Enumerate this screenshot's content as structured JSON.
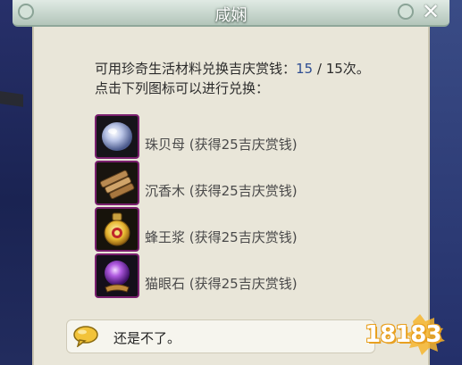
{
  "window": {
    "title": "咸娴",
    "close_glyph": "✕"
  },
  "info": {
    "line1_prefix": "可用珍奇生活材料兑换吉庆赏钱：",
    "current": "15",
    "separator": " / ",
    "total": "15次。",
    "line2": "点击下列图标可以进行兑换："
  },
  "items": [
    {
      "label": "珠贝母 (获得25吉庆赏钱)",
      "icon": "pearl-icon"
    },
    {
      "label": "沉香木 (获得25吉庆赏钱)",
      "icon": "wood-icon"
    },
    {
      "label": "蜂王浆 (获得25吉庆赏钱)",
      "icon": "royal-jelly-icon"
    },
    {
      "label": "猫眼石 (获得25吉庆赏钱)",
      "icon": "cat-eye-gem-icon"
    }
  ],
  "option": {
    "label": "还是不了。",
    "icon": "speech-bubble-icon"
  },
  "watermark": {
    "text": "18183"
  },
  "colors": {
    "panel_bg": "#e9e6d9",
    "count_blue": "#2d4d92",
    "slot_border": "#7a1f6e"
  }
}
